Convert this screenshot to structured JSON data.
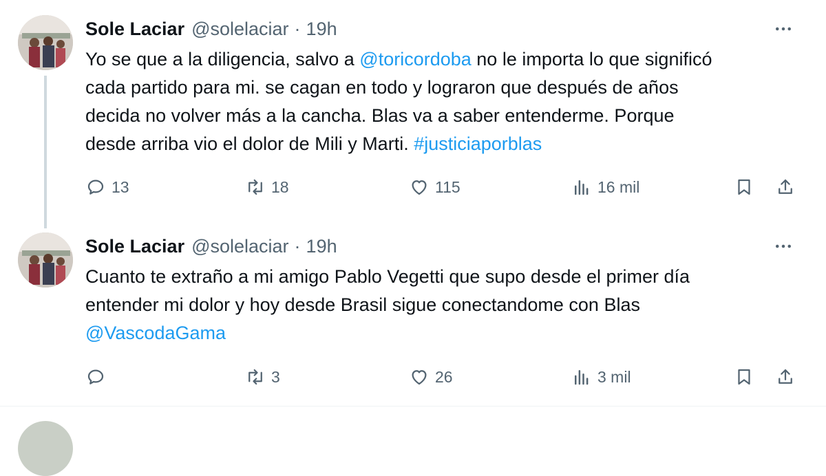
{
  "tweets": [
    {
      "name": "Sole Laciar",
      "handle": "@solelaciar",
      "dot": "·",
      "time": "19h",
      "body": {
        "l1a": "Yo se que a la diligencia, salvo a ",
        "l1link": "@toricordoba",
        "l1b": " no le importa lo que significó",
        "l2": "cada partido para mi. se cagan en todo y lograron que después de años",
        "l3": "decida no volver más a la cancha. Blas va a saber entenderme. Porque",
        "l4a": "desde arriba vio el dolor de Mili y Marti. ",
        "l4link": "#justiciaporblas"
      },
      "replies": "13",
      "retweets": "18",
      "likes": "115",
      "views": "16 mil"
    },
    {
      "name": "Sole Laciar",
      "handle": "@solelaciar",
      "dot": "·",
      "time": "19h",
      "body": {
        "l1": "Cuanto te extraño a mi amigo Pablo Vegetti que supo desde el primer día",
        "l2": "entender mi dolor y hoy desde Brasil sigue conectandome con Blas",
        "l3link": "@VascodaGama"
      },
      "replies": "",
      "retweets": "3",
      "likes": "26",
      "views": "3 mil"
    }
  ],
  "icons": {
    "more": "more-horizontal-icon",
    "reply": "reply-icon",
    "retweet": "retweet-icon",
    "like": "heart-icon",
    "views": "views-icon",
    "bookmark": "bookmark-icon",
    "share": "share-icon"
  },
  "colors": {
    "link": "#1d9bf0",
    "secondary": "#536471",
    "text": "#0f1419",
    "thread_line": "#cfd9de"
  }
}
